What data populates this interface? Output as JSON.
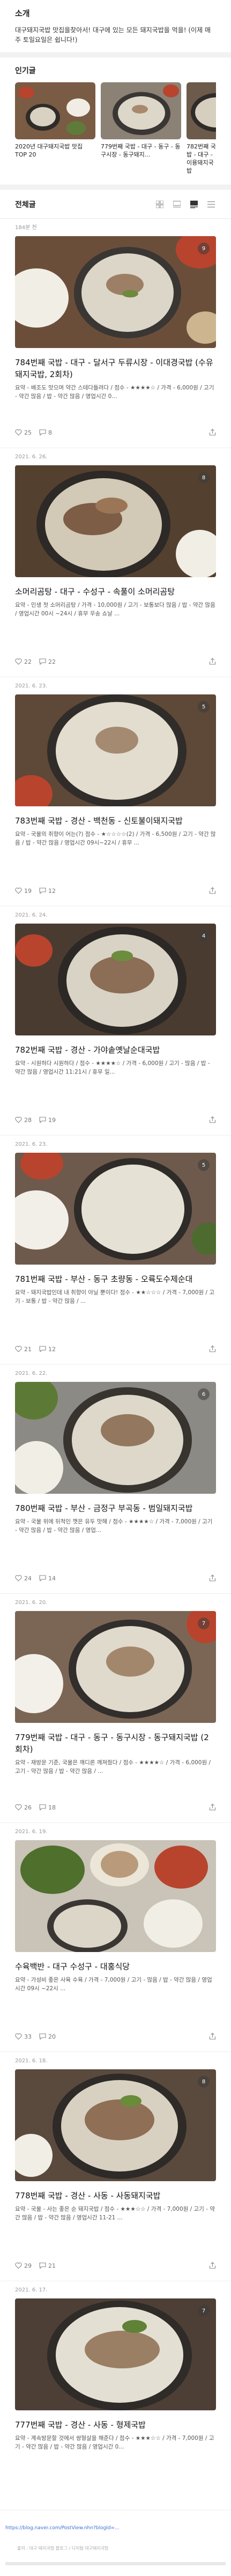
{
  "intro": {
    "title": "소개",
    "text": "대구돼지국밥 맛집을찾아서! 대구에 있는 모든 돼지국밥을 먹을! (이제 매주 토일요일은 쉽니다!)"
  },
  "popular": {
    "title": "인기글",
    "cards": [
      {
        "caption": "2020년 대구돼지국밥 맛집 TOP 20"
      },
      {
        "caption": "779번째 국밥 - 대구 - 동구 - 동구시장 - 동구돼지..."
      },
      {
        "caption": "782번째 국밥 - 대구 - 이용돼지국밥"
      }
    ]
  },
  "list": {
    "title": "전체글"
  },
  "posts": [
    {
      "date": "184분 전",
      "title": "784번째 국밥 - 대구 - 달서구 두류시장 - 이대경국밥 (수유돼지국밥, 2회차)",
      "desc": "요약 - 배조도 맛으며 약간 스테다들려다 / 점수 - ★★★★☆ / 가격 - 6,000원 / 고기 - 약간 많음 / 밥 - 약간 많음 / 영업시간 0...",
      "likes": "25",
      "comments": "8",
      "badge": "9"
    },
    {
      "date": "2021. 6. 26.",
      "title": "소머리곰탕 - 대구 - 수성구 - 속풀이 소머리곰탕",
      "desc": "요약 - 인생 첫 소머리곰탕 / 가격 - 10,000원 / 고기 - 보통보다 많음 / 밥 - 약간 많음 / 영업시간 00시 ~24시 / 휴무 우송 쇼날 ...",
      "likes": "22",
      "comments": "22",
      "badge": "8"
    },
    {
      "date": "2021. 6. 23.",
      "title": "783번째 국밥 - 경산 - 백천동 - 신토불이돼지국밥",
      "desc": "요약 - 국물의 취향이 어는(?) 점수 - ★☆☆☆☆(2) / 가격 - 6,500원 / 고기 - 약간 많음 / 밥 - 약간 많음 / 영업시간 09시~22시 / 휴무 ...",
      "likes": "19",
      "comments": "12",
      "badge": "5"
    },
    {
      "date": "2021. 6. 24.",
      "title": "782번째 국밥 - 경산 - 가야솥옛날순대국밥",
      "desc": "요약 - 시원하다 시원하다 / 점수 - ★★★★☆ / 가격 - 6,000원 / 고기 - 많음 / 밥 - 약간 많음 / 영업시간 11:21시 / 휴무 일...",
      "likes": "28",
      "comments": "19",
      "badge": "4"
    },
    {
      "date": "2021. 6. 23.",
      "title": "781번째 국밥 - 부산 - 동구 초량동 - 오륙도수제순대",
      "desc": "요약 - 돼지국밥인데 내 취향이 아닐 뿐이다! 점수 - ★★☆☆☆ / 가격 - 7,000원 / 고기 - 보통 / 밥 - 약간 많음 / ...",
      "likes": "21",
      "comments": "12",
      "badge": "5"
    },
    {
      "date": "2021. 6. 22.",
      "title": "780번째 국밥 - 부산 - 금정구 부곡동 - 범일돼지국밥",
      "desc": "요약 - 국물 위에 뒤적인 깻은 유두 맛해 / 점수 - ★★★★☆ / 가격 - 7,000원 / 고기 - 약간 많음 / 밥 - 약간 많음 / 영업...",
      "likes": "24",
      "comments": "14",
      "badge": "6"
    },
    {
      "date": "2021. 6. 20.",
      "title": "779번째 국밥 - 대구 - 동구 - 동구시장 - 동구돼지국밥 (2회차)",
      "desc": "요약 - 재방문 기준, 국물은 깨디론 깨져줬다 / 점수 - ★★★★☆ / 가격 - 6,000원 / 고기 - 약간 많음 / 밥 - 약간 많음 / ...",
      "likes": "26",
      "comments": "18",
      "badge": "7"
    },
    {
      "date": "2021. 6. 19.",
      "title": "수육백반 - 대구 수성구 - 대홍식당",
      "desc": "요약 - 가성비 좋은 사육 수육 / 가격 - 7,000원 / 고기 - 많음 / 밥 - 약간 많음 / 영업시간 09시 ~22시 ...",
      "likes": "33",
      "comments": "20",
      "badge": ""
    },
    {
      "date": "2021. 6. 18.",
      "title": "778번째 국밥 - 경산 - 사동 - 사동돼지국밥",
      "desc": "요약 - 국물 - 사는 좋은 순 돼지국밥 / 점수 - ★★★☆☆ / 가격 - 7,000원 / 고기 - 약간 많음 / 밥 - 약간 많음 / 영업시간 11-21 ...",
      "likes": "29",
      "comments": "21",
      "badge": "8"
    },
    {
      "date": "2021. 6. 17.",
      "title": "777번째 국밥 - 경산 - 사동 - 형제국밥",
      "desc": "요약 - 계속방문할 것에서 쌍형살을 해준다 / 점수 - ★★★☆☆ / 가격 - 7,000원 / 고기 - 약간 많음 / 밥 - 약간 많음 / 영업시간 0...",
      "likes": "",
      "comments": "",
      "badge": "7"
    }
  ],
  "footer": {
    "link": "https://blog.naver.com/PostView.nhn?blogId=...",
    "note": "출처 : 대구 돼지국밥 블로그 / 디지털 대구돼지국밥"
  },
  "colors": {
    "soup": "#dcd6c8",
    "bowl": "#3a3633",
    "table": "#6b4e3a",
    "rice": "#f1eee6",
    "kimchi": "#b8442e"
  }
}
